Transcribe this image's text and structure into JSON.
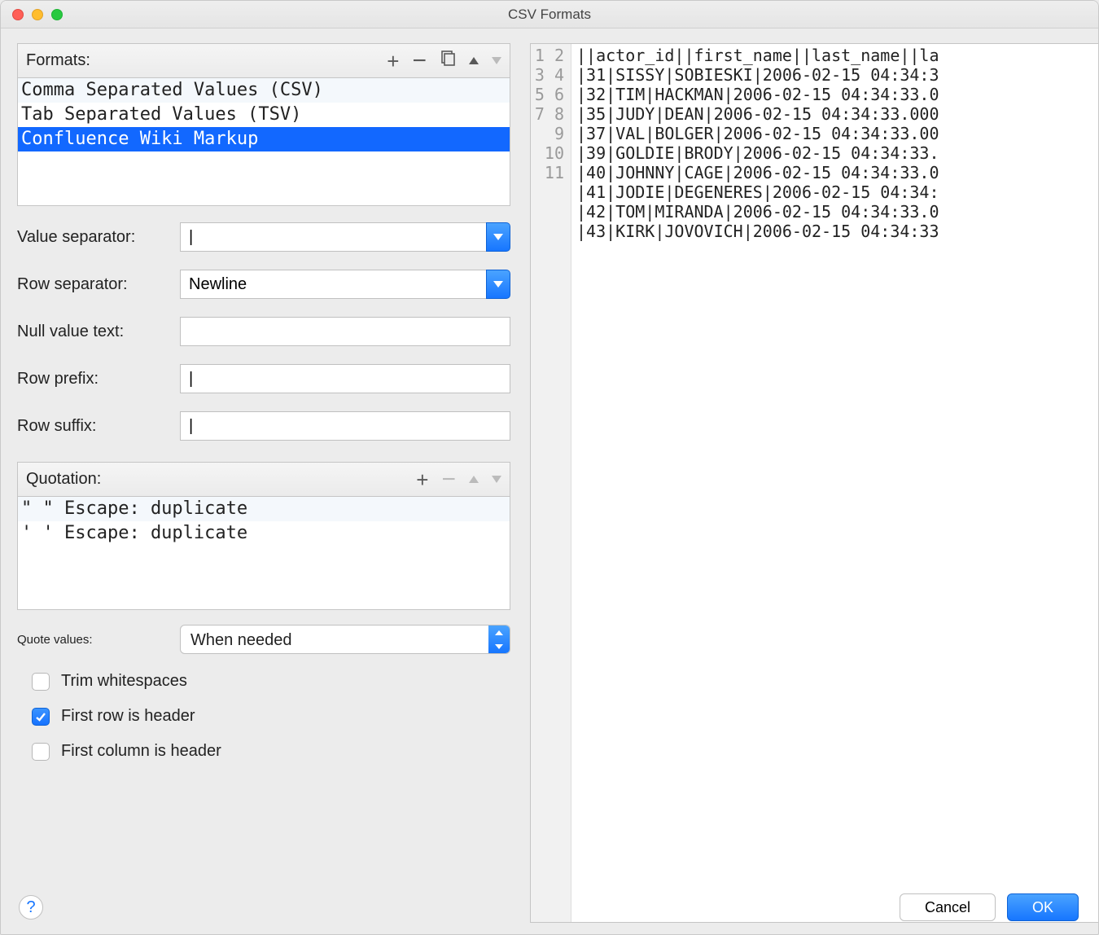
{
  "window": {
    "title": "CSV Formats"
  },
  "formats": {
    "label": "Formats:",
    "items": [
      {
        "name": "Comma Separated Values (CSV)",
        "selected": false
      },
      {
        "name": "Tab Separated Values (TSV)",
        "selected": false
      },
      {
        "name": "Confluence Wiki Markup",
        "selected": true
      }
    ]
  },
  "fields": {
    "value_separator": {
      "label": "Value separator:",
      "value": "|"
    },
    "row_separator": {
      "label": "Row separator:",
      "value": "Newline"
    },
    "null_text": {
      "label": "Null value text:",
      "value": ""
    },
    "row_prefix": {
      "label": "Row prefix:",
      "value": "|"
    },
    "row_suffix": {
      "label": "Row suffix:",
      "value": "|"
    }
  },
  "quotation": {
    "label": "Quotation:",
    "items": [
      {
        "open": "\"",
        "close": "\"",
        "escape": "duplicate"
      },
      {
        "open": "'",
        "close": "'",
        "escape": "duplicate"
      }
    ],
    "escape_label": "Escape:"
  },
  "quote_values": {
    "label": "Quote values:",
    "value": "When needed"
  },
  "checkboxes": {
    "trim": {
      "label": "Trim whitespaces",
      "checked": false
    },
    "first_row": {
      "label": "First row is header",
      "checked": true
    },
    "first_col": {
      "label": "First column is header",
      "checked": false
    }
  },
  "preview": {
    "lines": [
      "||actor_id||first_name||last_name||la",
      "|31|SISSY|SOBIESKI|2006-02-15 04:34:3",
      "|32|TIM|HACKMAN|2006-02-15 04:34:33.0",
      "|35|JUDY|DEAN|2006-02-15 04:34:33.000",
      "|37|VAL|BOLGER|2006-02-15 04:34:33.00",
      "|39|GOLDIE|BRODY|2006-02-15 04:34:33.",
      "|40|JOHNNY|CAGE|2006-02-15 04:34:33.0",
      "|41|JODIE|DEGENERES|2006-02-15 04:34:",
      "|42|TOM|MIRANDA|2006-02-15 04:34:33.0",
      "|43|KIRK|JOVOVICH|2006-02-15 04:34:33",
      ""
    ]
  },
  "buttons": {
    "cancel": "Cancel",
    "ok": "OK"
  }
}
